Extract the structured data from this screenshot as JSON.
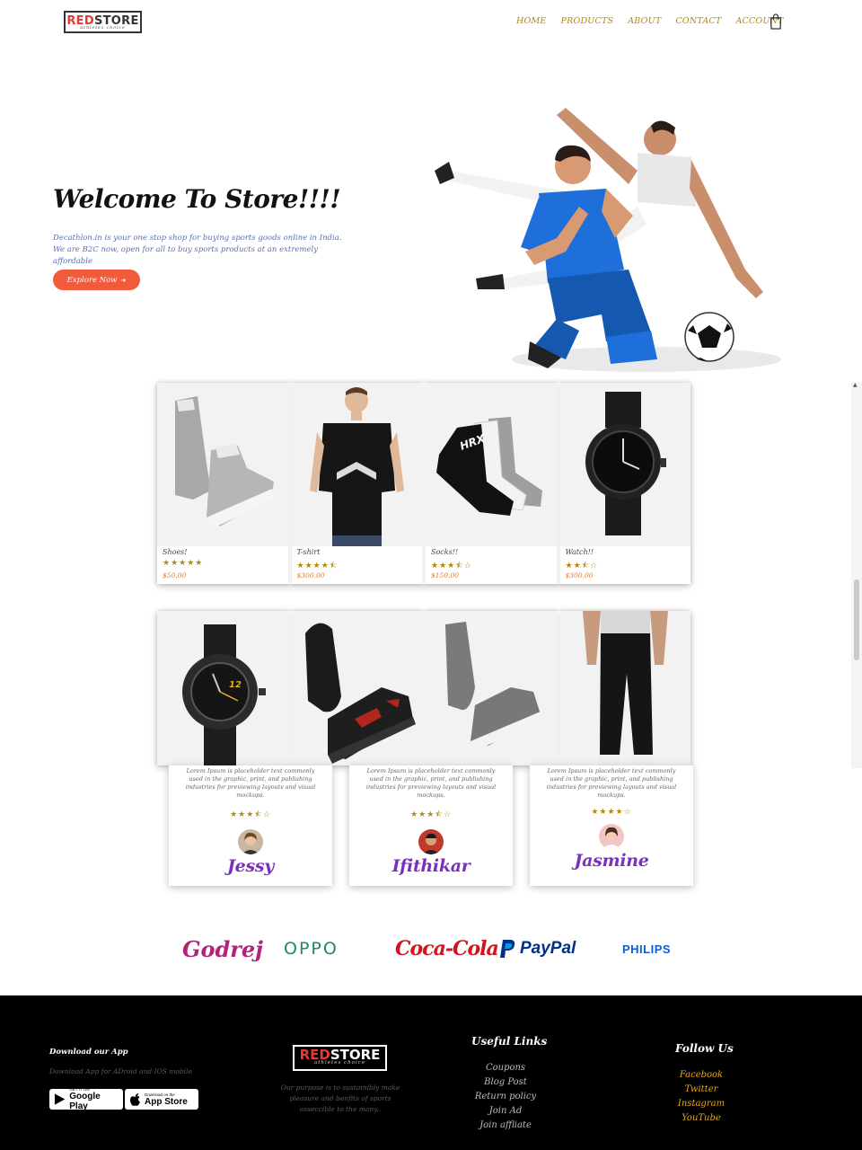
{
  "header": {
    "logo": {
      "red": "RED",
      "dark": "STORE",
      "tagline": "athletes choice"
    },
    "nav": [
      "HOME",
      "PRODUCTS",
      "ABOUT",
      "CONTACT",
      "ACCOUNT"
    ],
    "cart_icon": "shopping-bag-icon"
  },
  "hero": {
    "title": "Welcome To Store!!!!",
    "text_line1": "Decathlon.in is your one stop shop for buying sports goods online in India.",
    "text_line2": "We are B2C now, open for all to buy sports products at an extremely affordable",
    "button_label": "Explore Now",
    "button_icon": "arrow-right-icon",
    "image": "football-players-image"
  },
  "products_row1": [
    {
      "name": "Shoes!",
      "stars": "★★★★★",
      "price": "$50.00",
      "image": "sneakers-image"
    },
    {
      "name": "T-shirt",
      "stars": "★★★★⯪",
      "price": "$300.00",
      "image": "tshirt-model-image"
    },
    {
      "name": "Socks!!",
      "stars": "★★★⯪☆",
      "price": "$150.00",
      "image": "socks-image"
    },
    {
      "name": "Watch!!",
      "stars": "★★⯪☆",
      "price": "$300.00",
      "image": "black-watch-image"
    }
  ],
  "products_row2": [
    {
      "image": "sport-watch-image"
    },
    {
      "image": "running-shoes-image"
    },
    {
      "image": "slip-on-shoes-image"
    },
    {
      "image": "track-pants-image"
    }
  ],
  "testimonials": [
    {
      "quote": "Lorem Ipsum is placeholder text commonly used in the graphic, print, and publishing industries for previewing layouts and visual mockups.",
      "stars": "★★★⯪☆",
      "name": "Jessy"
    },
    {
      "quote": "Lorem Ipsum is placeholder text commonly used in the graphic, print, and publishing industries for previewing layouts and visual mockups.",
      "stars": "★★★⯪☆",
      "name": "Ifithikar"
    },
    {
      "quote": "Lorem Ipsum is placeholder text commonly used in the graphic, print, and publishing industries for previewing layouts and visual mockups.",
      "stars": "★★★★☆",
      "name": "Jasmine"
    }
  ],
  "brands": [
    "Godrej",
    "OPPO",
    "Coca-Cola",
    "PayPal",
    "PHILIPS"
  ],
  "footer": {
    "app_title": "Download our App",
    "app_text": "Download App for ADroid and IOS mobile",
    "google_play": {
      "small": "GET IT ON",
      "large": "Google Play"
    },
    "app_store": {
      "small": "Download on the",
      "large": "App Store"
    },
    "logo": {
      "red": "RED",
      "white": "STORE",
      "tagline": "athletes choice"
    },
    "purpose": "Our purpose is to sustainibly make pleasure and benfits of sports asseccible to the many..",
    "useful_links_title": "Useful Links",
    "useful_links": [
      "Coupons",
      "Blog Post",
      "Return policy",
      "Join Ad",
      "Join affliate"
    ],
    "follow_title": "Follow Us",
    "follow_links": [
      "Facebook",
      "Twitter",
      "Instagram",
      "YouTube"
    ]
  }
}
